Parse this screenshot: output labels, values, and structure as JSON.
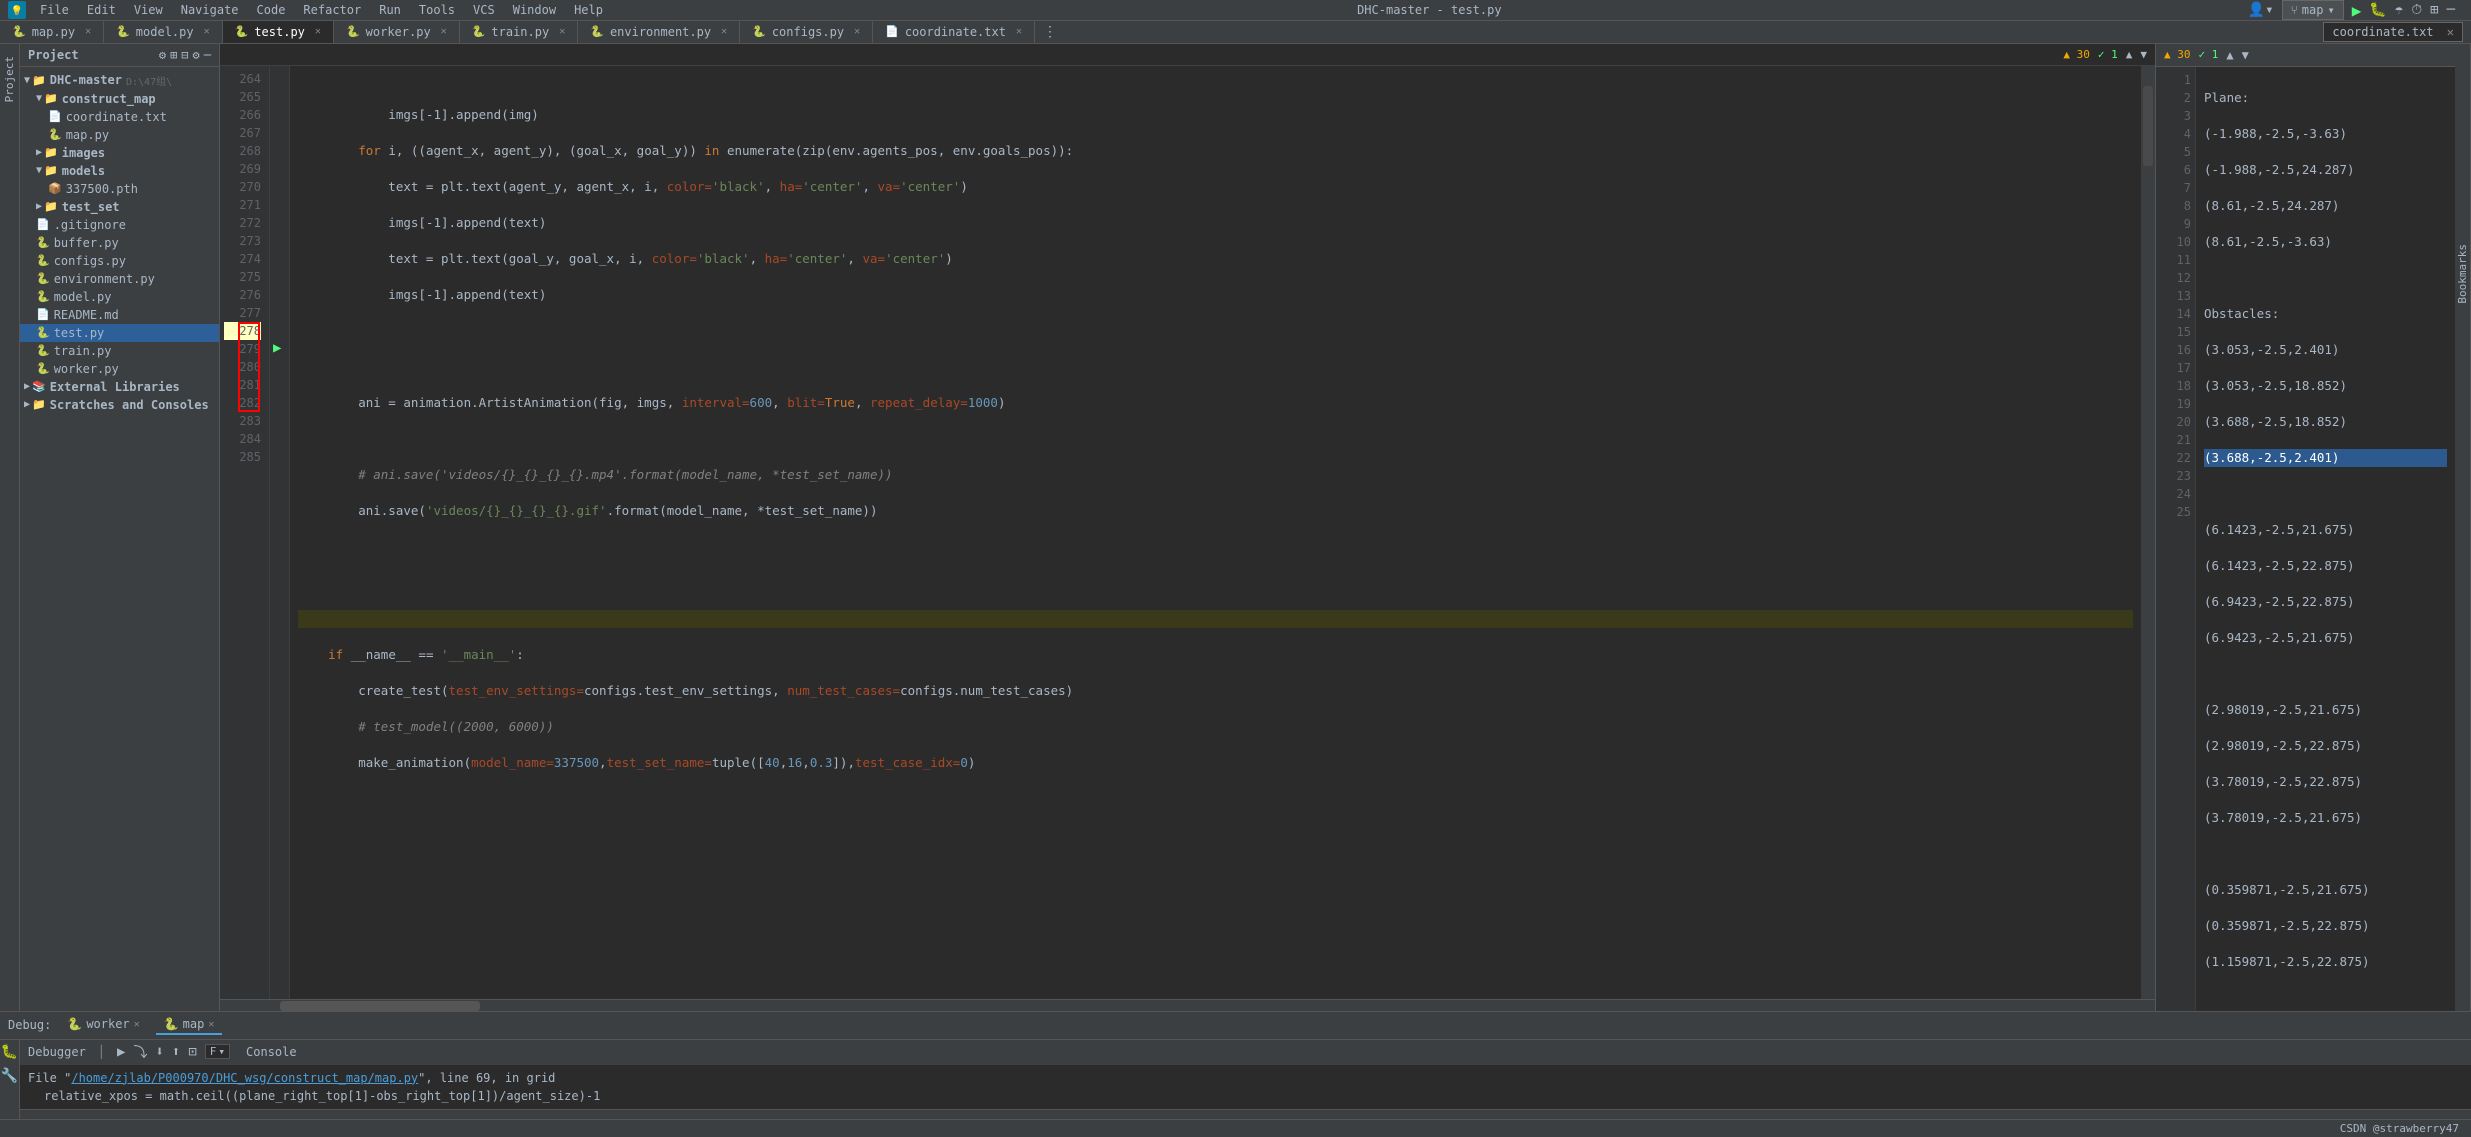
{
  "titlebar": {
    "menu_items": [
      "File",
      "Edit",
      "View",
      "Navigate",
      "Code",
      "Refactor",
      "Run",
      "Tools",
      "VCS",
      "Window",
      "Help"
    ],
    "title": "DHC-master - test.py",
    "branch": "map"
  },
  "tabs": [
    {
      "label": "map.py",
      "icon": "🐍",
      "active": false,
      "modified": false
    },
    {
      "label": "model.py",
      "icon": "🐍",
      "active": false,
      "modified": false
    },
    {
      "label": "test.py",
      "icon": "🐍",
      "active": true,
      "modified": false
    },
    {
      "label": "worker.py",
      "icon": "🐍",
      "active": false,
      "modified": false
    },
    {
      "label": "train.py",
      "icon": "🐍",
      "active": false,
      "modified": false
    },
    {
      "label": "environment.py",
      "icon": "🐍",
      "active": false,
      "modified": false
    },
    {
      "label": "configs.py",
      "icon": "🐍",
      "active": false,
      "modified": false
    },
    {
      "label": "coordinate.txt",
      "icon": "📄",
      "active": false,
      "modified": false
    }
  ],
  "right_panel": {
    "title": "coordinate.txt",
    "content_lines": [
      {
        "num": 1,
        "text": "Plane:"
      },
      {
        "num": 2,
        "text": "(-1.988,-2.5,-3.63)"
      },
      {
        "num": 3,
        "text": "(-1.988,-2.5,24.287)"
      },
      {
        "num": 4,
        "text": "(8.61,-2.5,24.287)"
      },
      {
        "num": 5,
        "text": "(8.61,-2.5,-3.63)"
      },
      {
        "num": 6,
        "text": ""
      },
      {
        "num": 7,
        "text": "Obstacles:"
      },
      {
        "num": 8,
        "text": "(3.053,-2.5,2.401)"
      },
      {
        "num": 9,
        "text": "(3.053,-2.5,18.852)"
      },
      {
        "num": 10,
        "text": "(3.688,-2.5,18.852)"
      },
      {
        "num": 11,
        "text": "(3.688,-2.5,2.401)",
        "highlight": true
      },
      {
        "num": 12,
        "text": ""
      },
      {
        "num": 13,
        "text": "(6.1423,-2.5,21.675)"
      },
      {
        "num": 14,
        "text": "(6.1423,-2.5,22.875)"
      },
      {
        "num": 15,
        "text": "(6.9423,-2.5,22.875)"
      },
      {
        "num": 16,
        "text": "(6.9423,-2.5,21.675)"
      },
      {
        "num": 17,
        "text": ""
      },
      {
        "num": 18,
        "text": "(2.98019,-2.5,21.675)"
      },
      {
        "num": 19,
        "text": "(2.98019,-2.5,22.875)"
      },
      {
        "num": 20,
        "text": "(3.78019,-2.5,22.875)"
      },
      {
        "num": 21,
        "text": "(3.78019,-2.5,21.675)"
      },
      {
        "num": 22,
        "text": ""
      },
      {
        "num": 23,
        "text": "(0.359871,-2.5,21.675)"
      },
      {
        "num": 24,
        "text": "(0.359871,-2.5,22.875)"
      },
      {
        "num": 25,
        "text": "(1.159871,-2.5,22.875)"
      }
    ]
  },
  "editor": {
    "filename": "test.py",
    "status": {
      "warnings": "▲ 30",
      "errors": "✓ 1",
      "nav_up": "▲",
      "nav_down": "▼"
    },
    "lines": [
      {
        "num": 264,
        "content": "            imgs[-1].append(img)"
      },
      {
        "num": 265,
        "content": "        for i, ((agent_x, agent_y), (goal_x, goal_y)) in enumerate(zip(env.agents_pos, env.goals_pos)):"
      },
      {
        "num": 266,
        "content": "            text = plt.text(agent_y, agent_x, i, color='black', ha='center', va='center')"
      },
      {
        "num": 267,
        "content": "            imgs[-1].append(text)"
      },
      {
        "num": 268,
        "content": "            text = plt.text(goal_y, goal_x, i, color='black', ha='center', va='center')"
      },
      {
        "num": 269,
        "content": "            imgs[-1].append(text)"
      },
      {
        "num": 270,
        "content": ""
      },
      {
        "num": 271,
        "content": ""
      },
      {
        "num": 272,
        "content": "        ani = animation.ArtistAnimation(fig, imgs, interval=600, blit=True, repeat_delay=1000)"
      },
      {
        "num": 273,
        "content": ""
      },
      {
        "num": 274,
        "content": "        # ani.save('videos/{}_{}_{}_{}.mp4'.format(model_name, *test_set_name))"
      },
      {
        "num": 275,
        "content": "        ani.save('videos/{}_{}_{}_{}.gif'.format(model_name, *test_set_name))"
      },
      {
        "num": 276,
        "content": ""
      },
      {
        "num": 277,
        "content": ""
      },
      {
        "num": 278,
        "content": ""
      },
      {
        "num": 279,
        "content": "    if __name__ == '__main__':"
      },
      {
        "num": 280,
        "content": "        create_test(test_env_settings=configs.test_env_settings, num_test_cases=configs.num_test_cases)"
      },
      {
        "num": 281,
        "content": "        # test_model((2000, 6000))"
      },
      {
        "num": 282,
        "content": "        make_animation(model_name=337500,test_set_name=tuple([40,16,0.3]),test_case_idx=0)"
      },
      {
        "num": 283,
        "content": ""
      },
      {
        "num": 284,
        "content": ""
      },
      {
        "num": 285,
        "content": ""
      }
    ]
  },
  "sidebar": {
    "root": "DHC-master",
    "root_path": "D:\\47组\\",
    "items": [
      {
        "name": "construct_map",
        "type": "folder",
        "expanded": true,
        "indent": 1
      },
      {
        "name": "coordinate.txt",
        "type": "txt",
        "indent": 2
      },
      {
        "name": "map.py",
        "type": "py",
        "indent": 2
      },
      {
        "name": "images",
        "type": "folder",
        "expanded": false,
        "indent": 1
      },
      {
        "name": "models",
        "type": "folder",
        "expanded": true,
        "indent": 1
      },
      {
        "name": "337500.pth",
        "type": "pth",
        "indent": 2
      },
      {
        "name": "test_set",
        "type": "folder",
        "expanded": false,
        "indent": 1
      },
      {
        "name": ".gitignore",
        "type": "gitignore",
        "indent": 1
      },
      {
        "name": "buffer.py",
        "type": "py",
        "indent": 1
      },
      {
        "name": "configs.py",
        "type": "py",
        "indent": 1
      },
      {
        "name": "environment.py",
        "type": "py",
        "indent": 1
      },
      {
        "name": "model.py",
        "type": "py",
        "indent": 1
      },
      {
        "name": "README.md",
        "type": "md",
        "indent": 1
      },
      {
        "name": "test.py",
        "type": "py",
        "indent": 1,
        "selected": true
      },
      {
        "name": "train.py",
        "type": "py",
        "indent": 1
      },
      {
        "name": "worker.py",
        "type": "py",
        "indent": 1
      },
      {
        "name": "External Libraries",
        "type": "folder",
        "expanded": false,
        "indent": 0
      },
      {
        "name": "Scratches and Consoles",
        "type": "folder",
        "expanded": false,
        "indent": 0
      }
    ]
  },
  "debug": {
    "label": "Debug:",
    "tabs": [
      {
        "label": "worker",
        "active": false
      },
      {
        "label": "map",
        "active": true
      }
    ],
    "toolbar": {
      "debugger_label": "Debugger",
      "filter_label": "F",
      "console_label": "Console"
    },
    "console_line1": "File \"/home/zjlab/P000970/DHC_wsg/construct_map/map.py\", line 69, in grid",
    "console_line1_link": "/home/zjlab/P000970/DHC_wsg/construct_map/map.py",
    "console_line2": "relative_xpos = math.ceil((plane_right_top[1]-obs_right_top[1])/agent_size)-1"
  },
  "status_bar": {
    "brand": "CSDN @strawberry47"
  }
}
